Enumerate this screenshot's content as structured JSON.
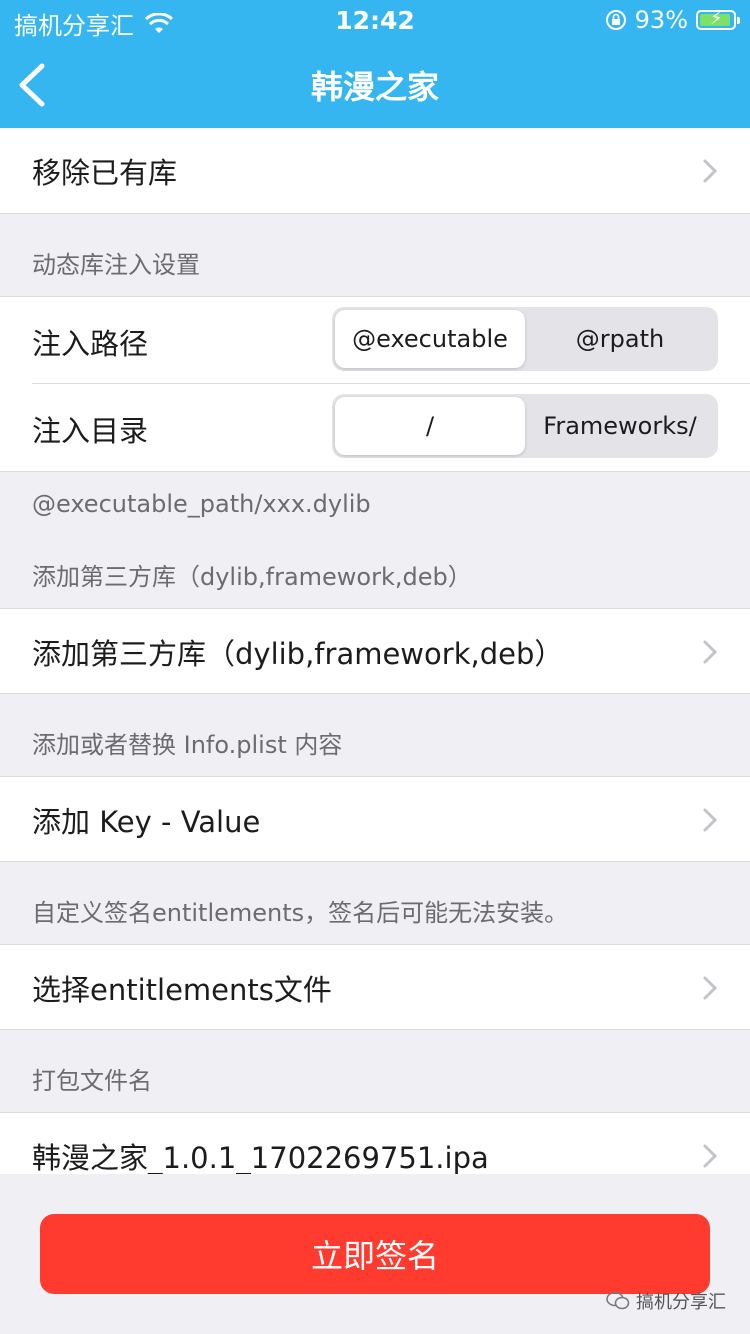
{
  "status_bar": {
    "carrier": "搞机分享汇",
    "time": "12:42",
    "battery_pct": "93%",
    "battery_level": 0.93
  },
  "nav": {
    "title": "韩漫之家"
  },
  "rows": {
    "remove_libs": "移除已有库",
    "inject_header": "动态库注入设置",
    "inject_path_label": "注入路径",
    "inject_path_opts": [
      "@executable",
      "@rpath"
    ],
    "inject_dir_label": "注入目录",
    "inject_dir_opts": [
      "/",
      "Frameworks/"
    ],
    "inject_note": "@executable_path/xxx.dylib",
    "thirdparty_header": "添加第三方库（dylib,framework,deb）",
    "thirdparty_cell": "添加第三方库（dylib,framework,deb）",
    "plist_header": "添加或者替换 Info.plist 内容",
    "plist_cell": "添加 Key - Value",
    "entitlements_header": "自定义签名entitlements，签名后可能无法安装。",
    "entitlements_cell": "选择entitlements文件",
    "filename_header": "打包文件名",
    "filename_cell": "韩漫之家_1.0.1_1702269751.ipa"
  },
  "footer": {
    "sign_button": "立即签名",
    "watermark": "搞机分享汇"
  },
  "colors": {
    "nav_bg": "#36b6f0",
    "button_bg": "#ff3b30",
    "background": "#efeff4"
  }
}
